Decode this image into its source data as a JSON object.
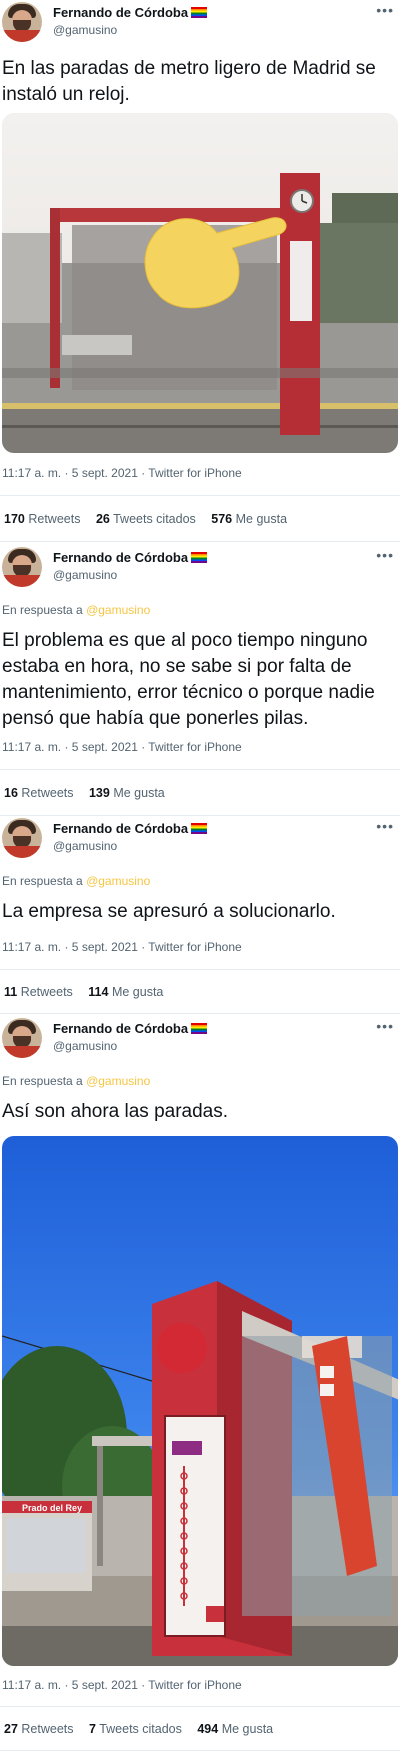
{
  "author": {
    "name": "Fernando de Córdoba",
    "handle": "@gamusino"
  },
  "reply_label": "En respuesta a",
  "reply_mention": "@gamusino",
  "tweets": [
    {
      "text": "En las paradas de metro ligero de Madrid se instaló un reloj.",
      "meta": "11:17 a. m. · 5 sept. 2021 · Twitter for iPhone",
      "stats": {
        "retweets_count": "170",
        "retweets_label": "Retweets",
        "quotes_count": "26",
        "quotes_label": "Tweets citados",
        "likes_count": "576",
        "likes_label": "Me gusta"
      }
    },
    {
      "text": "El problema es que al poco tiempo ninguno estaba en hora, no se sabe si por falta de mantenimiento, error técnico o porque nadie pensó que había que ponerles pilas.",
      "meta": "11:17 a. m. · 5 sept. 2021 · Twitter for iPhone",
      "stats": {
        "retweets_count": "16",
        "retweets_label": "Retweets",
        "likes_count": "139",
        "likes_label": "Me gusta"
      }
    },
    {
      "text": "La empresa se apresuró a solucionarlo.",
      "meta": "11:17 a. m. · 5 sept. 2021 · Twitter for iPhone",
      "stats": {
        "retweets_count": "11",
        "retweets_label": "Retweets",
        "likes_count": "114",
        "likes_label": "Me gusta"
      }
    },
    {
      "text": "Así son ahora las paradas.",
      "meta": "11:17 a. m. · 5 sept. 2021 · Twitter for iPhone",
      "stats": {
        "retweets_count": "27",
        "retweets_label": "Retweets",
        "quotes_count": "7",
        "quotes_label": "Tweets citados",
        "likes_count": "494",
        "likes_label": "Me gusta"
      }
    }
  ],
  "photo2_sign": "Prado del Rey",
  "colors": {
    "text": "#0f1419",
    "secondary": "#536471",
    "mention": "#f5c542",
    "divider": "#e6ecf0",
    "shelter_red": "#c8313b"
  }
}
